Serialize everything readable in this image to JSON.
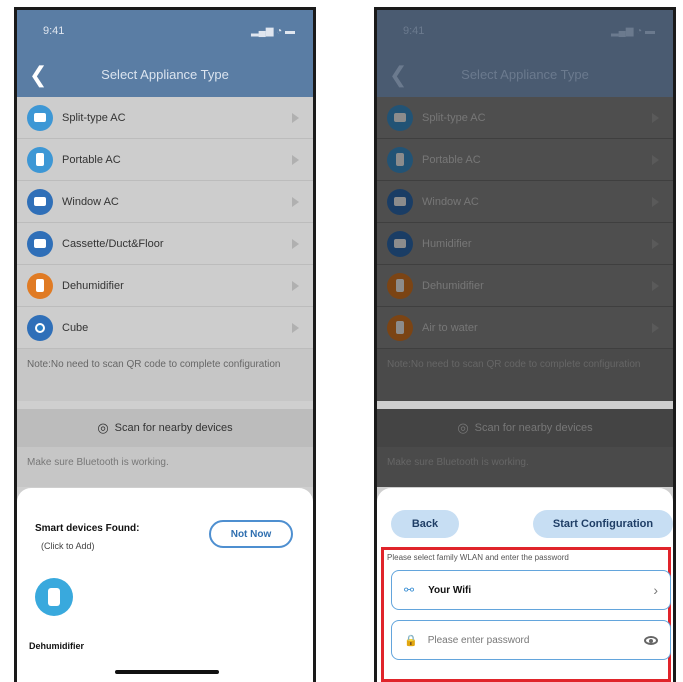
{
  "left": {
    "status": {
      "time": "9:41",
      "icons": "▂▄▆ ◔ ▬"
    },
    "nav": {
      "title": "Select Appliance Type"
    },
    "items": [
      {
        "label": "Split-type AC",
        "color": "#3d97d5",
        "icon": "split-ac-icon"
      },
      {
        "label": "Portable AC",
        "color": "#3d97d5",
        "icon": "portable-ac-icon"
      },
      {
        "label": "Window AC",
        "color": "#2f6fb8",
        "icon": "window-ac-icon"
      },
      {
        "label": "Cassette/Duct&Floor",
        "color": "#2f6fb8",
        "icon": "cassette-icon"
      },
      {
        "label": "Dehumidifier",
        "color": "#e07b24",
        "icon": "dehumidifier-icon"
      },
      {
        "label": "Cube",
        "color": "#2f6fb8",
        "icon": "cube-icon"
      }
    ],
    "note": "Note:No need to scan QR code to complete configuration",
    "scan_label": "Scan for nearby devices",
    "bt_text": "Make sure Bluetooth is working.",
    "sheet": {
      "title": "Smart devices Found:",
      "subtitle": "(Click to Add)",
      "not_now": "Not Now",
      "device_name": "Dehumidifier"
    }
  },
  "right": {
    "status": {
      "time": "9:41",
      "icons": "▂▄▆ ◔ ▬"
    },
    "nav": {
      "title": "Select Appliance Type"
    },
    "items": [
      {
        "label": "Split-type AC",
        "color": "#3d97d5",
        "icon": "split-ac-icon"
      },
      {
        "label": "Portable AC",
        "color": "#3d97d5",
        "icon": "portable-ac-icon"
      },
      {
        "label": "Window AC",
        "color": "#2f6fb8",
        "icon": "window-ac-icon"
      },
      {
        "label": "Humidifier",
        "color": "#2f6fb8",
        "icon": "humidifier-icon"
      },
      {
        "label": "Dehumidifier",
        "color": "#e07b24",
        "icon": "dehumidifier-icon"
      },
      {
        "label": "Air to water",
        "color": "#e07b24",
        "icon": "air-to-water-icon"
      }
    ],
    "note": "Note:No need to scan QR code to complete configuration",
    "scan_label": "Scan for nearby devices",
    "bt_text": "Make sure Bluetooth is working.",
    "sheet": {
      "back": "Back",
      "start": "Start Configuration",
      "wlan_hint": "Please select family WLAN and enter the password",
      "wifi_name": "Your Wifi",
      "password_placeholder": "Please enter password"
    }
  }
}
